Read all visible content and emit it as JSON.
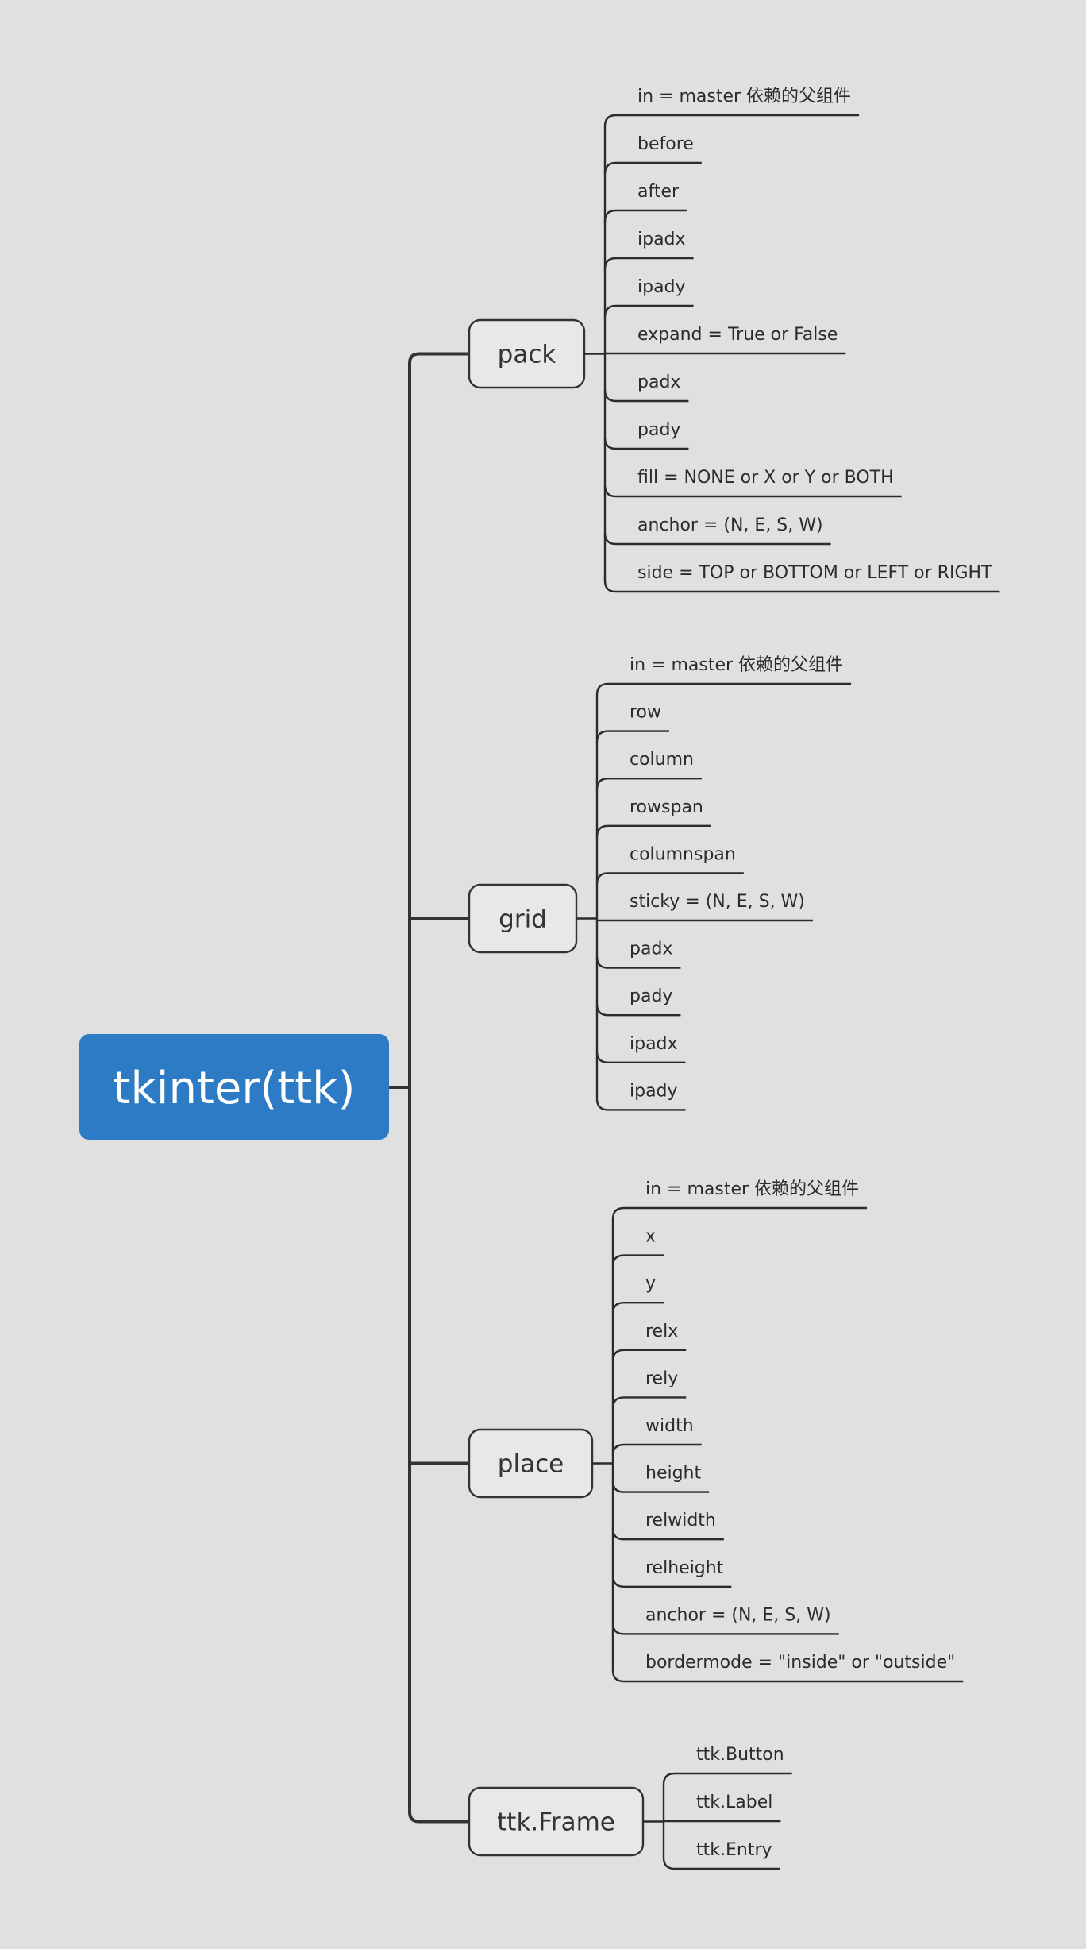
{
  "root": {
    "label": "tkinter(ttk)",
    "color": "#2C7BC4"
  },
  "colors": {
    "background": "#E0E0E0",
    "line": "#333333",
    "node_fill": "#E8E8E8",
    "text": "#333333"
  },
  "branches": [
    {
      "label": "pack",
      "children": [
        "in = master 依赖的父组件",
        "before",
        "after",
        "ipadx",
        "ipady",
        "expand = True or False",
        "padx",
        "pady",
        "fill = NONE or X or Y or BOTH",
        "anchor = (N, E, S, W)",
        "side = TOP or BOTTOM or LEFT or RIGHT"
      ]
    },
    {
      "label": "grid",
      "children": [
        "in = master 依赖的父组件",
        "row",
        "column",
        "rowspan",
        "columnspan",
        "sticky = (N, E, S, W)",
        "padx",
        "pady",
        "ipadx",
        "ipady"
      ]
    },
    {
      "label": "place",
      "children": [
        "in = master 依赖的父组件",
        "x",
        "y",
        "relx",
        "rely",
        "width",
        "height",
        "relwidth",
        "relheight",
        "anchor = (N, E, S, W)",
        "bordermode = \"inside\" or \"outside\""
      ]
    },
    {
      "label": "ttk.Frame",
      "children": [
        "ttk.Button",
        "ttk.Label",
        "ttk.Entry"
      ]
    }
  ]
}
